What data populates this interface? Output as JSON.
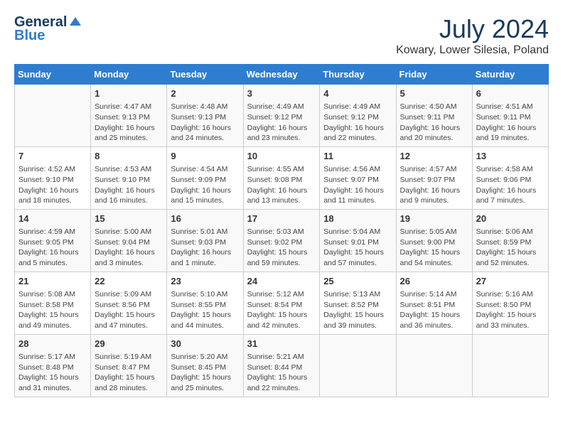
{
  "logo": {
    "general": "General",
    "blue": "Blue"
  },
  "title": "July 2024",
  "location": "Kowary, Lower Silesia, Poland",
  "days_of_week": [
    "Sunday",
    "Monday",
    "Tuesday",
    "Wednesday",
    "Thursday",
    "Friday",
    "Saturday"
  ],
  "weeks": [
    [
      {
        "day": "",
        "info": ""
      },
      {
        "day": "1",
        "info": "Sunrise: 4:47 AM\nSunset: 9:13 PM\nDaylight: 16 hours\nand 25 minutes."
      },
      {
        "day": "2",
        "info": "Sunrise: 4:48 AM\nSunset: 9:13 PM\nDaylight: 16 hours\nand 24 minutes."
      },
      {
        "day": "3",
        "info": "Sunrise: 4:49 AM\nSunset: 9:12 PM\nDaylight: 16 hours\nand 23 minutes."
      },
      {
        "day": "4",
        "info": "Sunrise: 4:49 AM\nSunset: 9:12 PM\nDaylight: 16 hours\nand 22 minutes."
      },
      {
        "day": "5",
        "info": "Sunrise: 4:50 AM\nSunset: 9:11 PM\nDaylight: 16 hours\nand 20 minutes."
      },
      {
        "day": "6",
        "info": "Sunrise: 4:51 AM\nSunset: 9:11 PM\nDaylight: 16 hours\nand 19 minutes."
      }
    ],
    [
      {
        "day": "7",
        "info": "Sunrise: 4:52 AM\nSunset: 9:10 PM\nDaylight: 16 hours\nand 18 minutes."
      },
      {
        "day": "8",
        "info": "Sunrise: 4:53 AM\nSunset: 9:10 PM\nDaylight: 16 hours\nand 16 minutes."
      },
      {
        "day": "9",
        "info": "Sunrise: 4:54 AM\nSunset: 9:09 PM\nDaylight: 16 hours\nand 15 minutes."
      },
      {
        "day": "10",
        "info": "Sunrise: 4:55 AM\nSunset: 9:08 PM\nDaylight: 16 hours\nand 13 minutes."
      },
      {
        "day": "11",
        "info": "Sunrise: 4:56 AM\nSunset: 9:07 PM\nDaylight: 16 hours\nand 11 minutes."
      },
      {
        "day": "12",
        "info": "Sunrise: 4:57 AM\nSunset: 9:07 PM\nDaylight: 16 hours\nand 9 minutes."
      },
      {
        "day": "13",
        "info": "Sunrise: 4:58 AM\nSunset: 9:06 PM\nDaylight: 16 hours\nand 7 minutes."
      }
    ],
    [
      {
        "day": "14",
        "info": "Sunrise: 4:59 AM\nSunset: 9:05 PM\nDaylight: 16 hours\nand 5 minutes."
      },
      {
        "day": "15",
        "info": "Sunrise: 5:00 AM\nSunset: 9:04 PM\nDaylight: 16 hours\nand 3 minutes."
      },
      {
        "day": "16",
        "info": "Sunrise: 5:01 AM\nSunset: 9:03 PM\nDaylight: 16 hours\nand 1 minute."
      },
      {
        "day": "17",
        "info": "Sunrise: 5:03 AM\nSunset: 9:02 PM\nDaylight: 15 hours\nand 59 minutes."
      },
      {
        "day": "18",
        "info": "Sunrise: 5:04 AM\nSunset: 9:01 PM\nDaylight: 15 hours\nand 57 minutes."
      },
      {
        "day": "19",
        "info": "Sunrise: 5:05 AM\nSunset: 9:00 PM\nDaylight: 15 hours\nand 54 minutes."
      },
      {
        "day": "20",
        "info": "Sunrise: 5:06 AM\nSunset: 8:59 PM\nDaylight: 15 hours\nand 52 minutes."
      }
    ],
    [
      {
        "day": "21",
        "info": "Sunrise: 5:08 AM\nSunset: 8:58 PM\nDaylight: 15 hours\nand 49 minutes."
      },
      {
        "day": "22",
        "info": "Sunrise: 5:09 AM\nSunset: 8:56 PM\nDaylight: 15 hours\nand 47 minutes."
      },
      {
        "day": "23",
        "info": "Sunrise: 5:10 AM\nSunset: 8:55 PM\nDaylight: 15 hours\nand 44 minutes."
      },
      {
        "day": "24",
        "info": "Sunrise: 5:12 AM\nSunset: 8:54 PM\nDaylight: 15 hours\nand 42 minutes."
      },
      {
        "day": "25",
        "info": "Sunrise: 5:13 AM\nSunset: 8:52 PM\nDaylight: 15 hours\nand 39 minutes."
      },
      {
        "day": "26",
        "info": "Sunrise: 5:14 AM\nSunset: 8:51 PM\nDaylight: 15 hours\nand 36 minutes."
      },
      {
        "day": "27",
        "info": "Sunrise: 5:16 AM\nSunset: 8:50 PM\nDaylight: 15 hours\nand 33 minutes."
      }
    ],
    [
      {
        "day": "28",
        "info": "Sunrise: 5:17 AM\nSunset: 8:48 PM\nDaylight: 15 hours\nand 31 minutes."
      },
      {
        "day": "29",
        "info": "Sunrise: 5:19 AM\nSunset: 8:47 PM\nDaylight: 15 hours\nand 28 minutes."
      },
      {
        "day": "30",
        "info": "Sunrise: 5:20 AM\nSunset: 8:45 PM\nDaylight: 15 hours\nand 25 minutes."
      },
      {
        "day": "31",
        "info": "Sunrise: 5:21 AM\nSunset: 8:44 PM\nDaylight: 15 hours\nand 22 minutes."
      },
      {
        "day": "",
        "info": ""
      },
      {
        "day": "",
        "info": ""
      },
      {
        "day": "",
        "info": ""
      }
    ]
  ]
}
